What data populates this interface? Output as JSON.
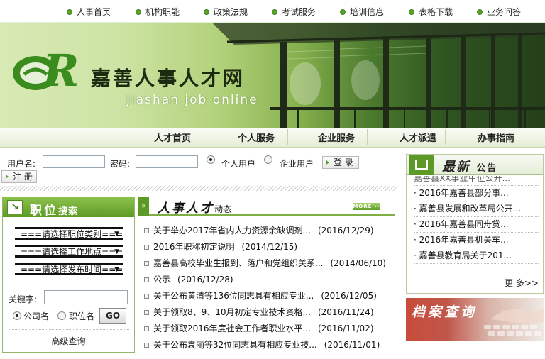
{
  "top_nav": {
    "items": [
      "人事首页",
      "机构职能",
      "政策法规",
      "考试服务",
      "培训信息",
      "表格下载",
      "业务问答"
    ]
  },
  "banner": {
    "site_title": "嘉善人事人才网",
    "subtitle": "Jiashan job online"
  },
  "main_nav": {
    "items": [
      "人才首页",
      "个人服务",
      "企业服务",
      "人才派遣",
      "办事指南"
    ]
  },
  "login": {
    "username_label": "用户名:",
    "password_label": "密码:",
    "personal_user": "个人用户",
    "company_user": "企业用户",
    "login_button": "登 录",
    "register_button": "注 册",
    "selected_user_type": "个人用户"
  },
  "job_search": {
    "title_main": "职位",
    "title_sub": "搜索",
    "select_category": "===请选择职位类别===",
    "select_location": "===请选择工作地点===",
    "select_time": "===请选择发布时间===",
    "keyword_label": "关键字:",
    "option_company": "公司名",
    "option_position": "职位名",
    "selected_option": "公司名",
    "go_button": "GO",
    "advanced_link": "高级查询"
  },
  "news": {
    "title_main": "人事人才",
    "title_sub": "动态",
    "more_label": "MORE",
    "items": [
      {
        "title": "关于举办2017年省内人力资源余缺调剂...",
        "date": "(2016/12/29)"
      },
      {
        "title": "2016年职称初定说明",
        "date": "(2014/12/15)"
      },
      {
        "title": "嘉善县高校毕业生报到、落户和党组织关系...",
        "date": "(2014/06/10)"
      },
      {
        "title": "公示",
        "date": "(2016/12/28)"
      },
      {
        "title": "关于公布黄清等136位同志具有相应专业...",
        "date": "(2016/12/05)"
      },
      {
        "title": "关于领取8、9、10月初定专业技术资格...",
        "date": "(2016/11/24)"
      },
      {
        "title": "关于领取2016年度社会工作者职业水平...",
        "date": "(2016/11/02)"
      },
      {
        "title": "关于公布袁丽等32位同志具有相应专业技...",
        "date": "(2016/11/01)"
      }
    ]
  },
  "notice": {
    "title_main": "最新",
    "title_sub": "公告",
    "items": [
      "嘉善县XX事业单位公开...",
      "2016年嘉善县部分事...",
      "嘉善县发展和改革局公开...",
      "2016年嘉善县同舟贷...",
      "2016年嘉善县机关车...",
      "嘉善县教育局关于201..."
    ],
    "more_label": "更 多>>"
  },
  "archive": {
    "title": "档案查询"
  },
  "colors": {
    "brand_green": "#5d9a25",
    "banner_dark": "#2f5420",
    "archive_red": "#c74c3a"
  }
}
